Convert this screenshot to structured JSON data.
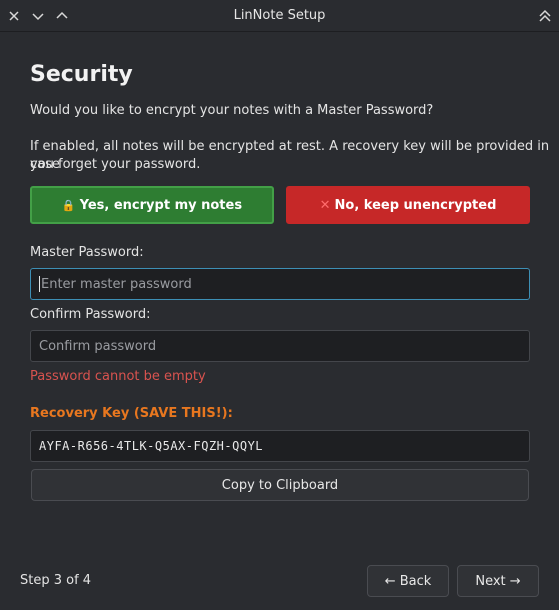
{
  "window": {
    "title": "LinNote Setup"
  },
  "heading": "Security",
  "question": "Would you like to encrypt your notes with a Master Password?",
  "description_line1": "If enabled, all notes will be encrypted at rest. A recovery key will be provided in case",
  "description_line2": "you forget your password.",
  "buttons": {
    "yes_label": "Yes, encrypt my notes",
    "no_label": "No, keep unencrypted"
  },
  "master_password": {
    "label": "Master Password:",
    "placeholder": "Enter master password"
  },
  "confirm_password": {
    "label": "Confirm Password:",
    "placeholder": "Confirm password"
  },
  "error": "Password cannot be empty",
  "recovery": {
    "title": "Recovery Key (SAVE THIS!):",
    "key": "AYFA-R656-4TLK-Q5AX-FQZH-QQYL",
    "copy_label": "Copy to Clipboard"
  },
  "footer": {
    "step": "Step 3 of 4",
    "back_label": "← Back",
    "next_label": "Next →"
  },
  "colors": {
    "accent_green": "#2e7d32",
    "accent_red": "#c62828",
    "recovery_orange": "#e8771f",
    "error_red": "#d9534f",
    "focus_blue": "#3d8fb5"
  },
  "icons": {
    "yes": "lock-icon",
    "no": "cross-icon"
  }
}
